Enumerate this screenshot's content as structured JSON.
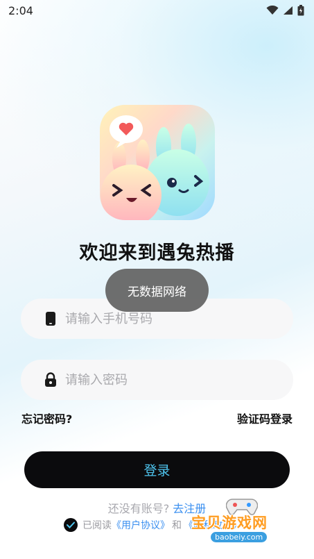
{
  "status_bar": {
    "time": "2:04"
  },
  "welcome_title": "欢迎来到遇兔热播",
  "toast": "无数据网络",
  "phone_field": {
    "placeholder": "请输入手机号码",
    "icon": "phone-icon"
  },
  "password_field": {
    "placeholder": "请输入密码",
    "icon": "lock-icon"
  },
  "links": {
    "forgot_password": "忘记密码?",
    "sms_login": "验证码登录"
  },
  "login_button": "登录",
  "register": {
    "prompt": "还没有账号?",
    "link": "去注册"
  },
  "agreement": {
    "prefix": "已阅读",
    "user_agreement": "《用户协议》",
    "conjunction": "和",
    "privacy": "《隐私政策》"
  },
  "watermark": {
    "text": "宝贝游戏网",
    "url": "baobeiy.com"
  },
  "colors": {
    "button_bg": "#0b0b0d",
    "button_text": "#4fc6f0",
    "link": "#3a8ff0",
    "toast_bg": "#666666"
  }
}
